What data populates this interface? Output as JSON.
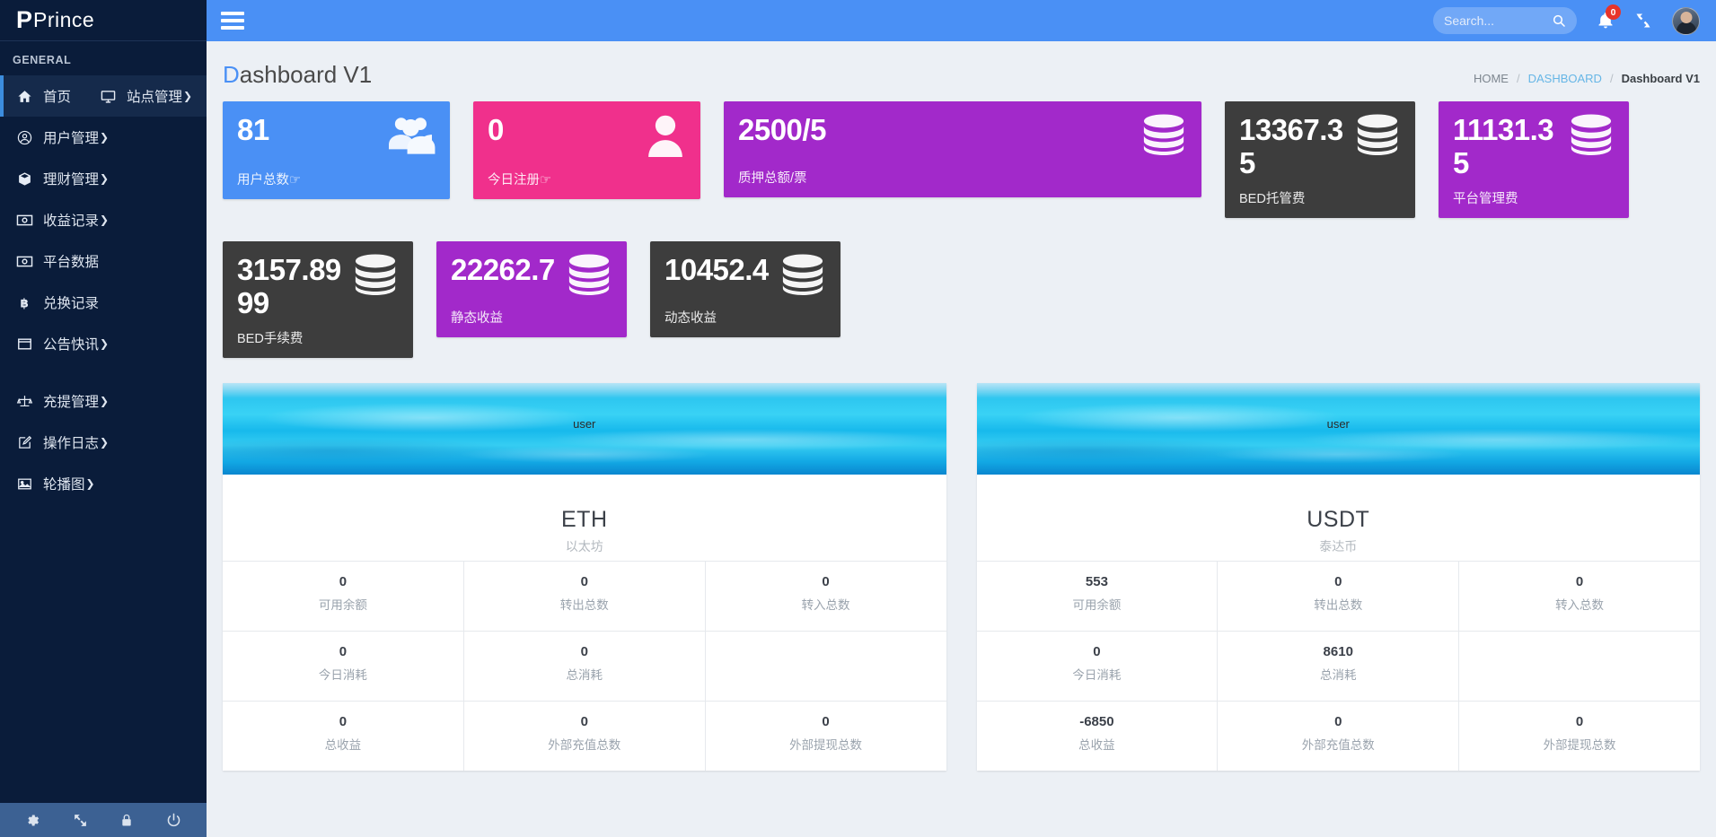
{
  "brand": {
    "mark": "P",
    "name": "Prince"
  },
  "sidebar": {
    "section_label": "GENERAL",
    "items": [
      {
        "label": "首页",
        "icon": "home-icon",
        "caret": "",
        "active": true
      },
      {
        "label": "用户管理",
        "icon": "user-circle-icon",
        "caret": "❯"
      },
      {
        "label": "理财管理",
        "icon": "box-icon",
        "caret": "❯"
      },
      {
        "label": "收益记录",
        "icon": "money-icon",
        "caret": "❯"
      },
      {
        "label": "平台数据",
        "icon": "money-icon",
        "caret": ""
      },
      {
        "label": "兑换记录",
        "icon": "bitcoin-icon",
        "caret": ""
      },
      {
        "label": "公告快讯",
        "icon": "window-icon",
        "caret": "❯"
      },
      {
        "label": "充提管理",
        "icon": "balance-scale-icon",
        "caret": "❯"
      },
      {
        "label": "操作日志",
        "icon": "edit-icon",
        "caret": "❯"
      },
      {
        "label": "轮播图",
        "icon": "image-icon",
        "caret": "❯"
      }
    ],
    "overflow_item": {
      "label": "站点管理",
      "icon": "monitor-icon",
      "caret": "❯"
    },
    "footer_icons": [
      "gear-icon",
      "expand-icon",
      "lock-icon",
      "power-icon"
    ]
  },
  "topbar": {
    "menu_toggle": "hamburger-icon",
    "search": {
      "value": "",
      "placeholder": "Search..."
    },
    "notifications_count": "0",
    "fullscreen_icon": "expand-icon",
    "avatar": "user-avatar"
  },
  "page": {
    "title_first": "D",
    "title_rest": "ashboard V1",
    "breadcrumb": [
      {
        "label": "HOME",
        "type": "plain"
      },
      {
        "label": "DASHBOARD",
        "type": "link"
      },
      {
        "label": "Dashboard V1",
        "type": "current"
      }
    ],
    "separator": "/"
  },
  "stats": [
    {
      "value": "81",
      "label": "用户总数☞",
      "color": "#4a90f5",
      "icon": "users-icon",
      "width": "w-users"
    },
    {
      "value": "0",
      "label": "今日注册☞",
      "color": "#f0308c",
      "icon": "user-icon",
      "width": "w-today"
    },
    {
      "value": "2500/5",
      "label": "质押总额/票",
      "color": "#a229ca",
      "icon": "database-icon",
      "width": "w-pledge"
    },
    {
      "value": "13367.35",
      "label": "BED托管费",
      "color": "#3d3d3d",
      "icon": "database-icon",
      "width": "w-narrow"
    },
    {
      "value": "11131.35",
      "label": "平台管理费",
      "color": "#a229ca",
      "icon": "database-icon",
      "width": "w-narrow"
    },
    {
      "value": "3157.8999",
      "label": "BED手续费",
      "color": "#3d3d3d",
      "icon": "database-icon",
      "width": "w-narrow"
    },
    {
      "value": "22262.7",
      "label": "静态收益",
      "color": "#a229ca",
      "icon": "database-icon",
      "width": "w-narrow"
    },
    {
      "value": "10452.4",
      "label": "动态收益",
      "color": "#3d3d3d",
      "icon": "database-icon",
      "width": "w-narrow"
    }
  ],
  "coins": [
    {
      "banner_user": "user",
      "symbol": "ETH",
      "name": "以太坊",
      "rows": [
        [
          {
            "v": "0",
            "k": "可用余额"
          },
          {
            "v": "0",
            "k": "转出总数"
          },
          {
            "v": "0",
            "k": "转入总数"
          }
        ],
        [
          {
            "v": "0",
            "k": "今日消耗"
          },
          {
            "v": "0",
            "k": "总消耗"
          },
          {
            "v": "",
            "k": ""
          }
        ],
        [
          {
            "v": "0",
            "k": "总收益"
          },
          {
            "v": "0",
            "k": "外部充值总数"
          },
          {
            "v": "0",
            "k": "外部提现总数"
          }
        ]
      ]
    },
    {
      "banner_user": "user",
      "symbol": "USDT",
      "name": "泰达币",
      "rows": [
        [
          {
            "v": "553",
            "k": "可用余额"
          },
          {
            "v": "0",
            "k": "转出总数"
          },
          {
            "v": "0",
            "k": "转入总数"
          }
        ],
        [
          {
            "v": "0",
            "k": "今日消耗"
          },
          {
            "v": "8610",
            "k": "总消耗"
          },
          {
            "v": "",
            "k": ""
          }
        ],
        [
          {
            "v": "-6850",
            "k": "总收益"
          },
          {
            "v": "0",
            "k": "外部充值总数"
          },
          {
            "v": "0",
            "k": "外部提现总数"
          }
        ]
      ]
    }
  ]
}
